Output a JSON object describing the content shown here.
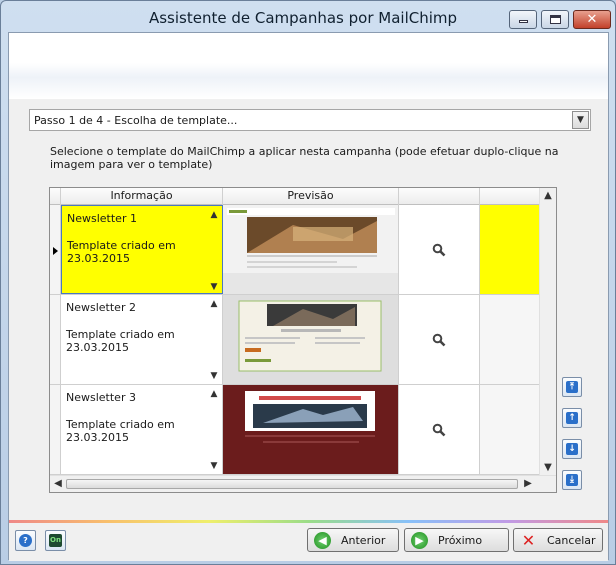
{
  "window": {
    "title": "Assistente de Campanhas por MailChimp"
  },
  "step": {
    "value": "Passo 1 de 4 - Escolha de template..."
  },
  "instructions": "Selecione o template do MailChimp a aplicar nesta campanha (pode efetuar duplo-clique na imagem para ver o template)",
  "grid": {
    "columns": [
      "Informação",
      "Previsão"
    ],
    "rows": [
      {
        "name": "Newsletter 1",
        "desc": "Template criado em 23.03.2015",
        "selected": true
      },
      {
        "name": "Newsletter 2",
        "desc": "Template criado em 23.03.2015",
        "selected": false
      },
      {
        "name": "Newsletter 3",
        "desc": "Template criado em 23.03.2015",
        "selected": false
      }
    ]
  },
  "footer": {
    "prev_label": "Anterior",
    "next_label": "Próximo",
    "cancel_label": "Cancelar"
  },
  "colors": {
    "selected_row": "#ffff00",
    "preview3_bg": "#6b1c1c",
    "accent": "#2a6fc9"
  },
  "icons": {
    "view": "magnifier-icon",
    "order": [
      "move-top-icon",
      "move-up-icon",
      "move-down-icon",
      "move-bottom-icon"
    ]
  }
}
